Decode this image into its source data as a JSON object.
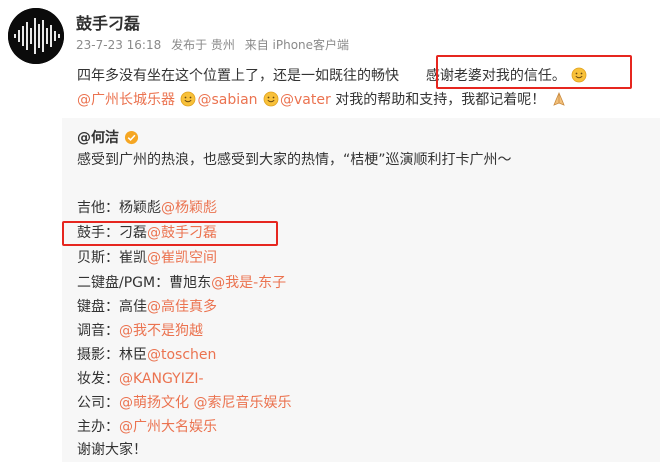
{
  "post": {
    "author": "鼓手刁磊",
    "meta": {
      "date": "23-7-23 16:18",
      "location": "发布于 贵州",
      "device": "来自 iPhone客户端"
    },
    "line1_text": "四年多没有坐在这个位置上了，还是一如既往的畅快",
    "line1_highlight": "感谢老婆对我的信任。",
    "line2": {
      "m1": "@广州长城乐器",
      "m2": "@sabian",
      "m3": "@vater",
      "tail": "对我的帮助和支持，我都记着呢！"
    }
  },
  "quote": {
    "author": "@何洁",
    "line1": "感受到广州的热浪，也感受到大家的热情，“桔梗”巡演顺利打卡广州～",
    "credits": [
      {
        "role": "吉他：杨颖彪",
        "mention": "@杨颖彪"
      },
      {
        "role": "鼓手：刁磊",
        "mention": "@鼓手刁磊"
      },
      {
        "role": "贝斯：崔凯",
        "mention": "@崔凯空间"
      },
      {
        "role": "二键盘/PGM：曹旭东",
        "mention": "@我是-东子"
      },
      {
        "role": "键盘：高佳",
        "mention": "@高佳真多"
      },
      {
        "role": "调音：",
        "mention": "@我不是狗越"
      },
      {
        "role": "摄影：林臣",
        "mention": "@toschen"
      },
      {
        "role": "妆发：",
        "mention": "@KANGYIZI-"
      },
      {
        "role": "公司：",
        "mention": "@萌扬文化 @索尼音乐娱乐"
      },
      {
        "role": "主办：",
        "mention": "@广州大名娱乐"
      }
    ],
    "closing": "谢谢大家！"
  },
  "colors": {
    "mention": "#eb7350",
    "highlight_box": "#e6261f",
    "verified": "#f5a623"
  },
  "icons": [
    "avatar-waveform",
    "smile-emoji",
    "pray-emoji",
    "verified-badge-icon"
  ]
}
